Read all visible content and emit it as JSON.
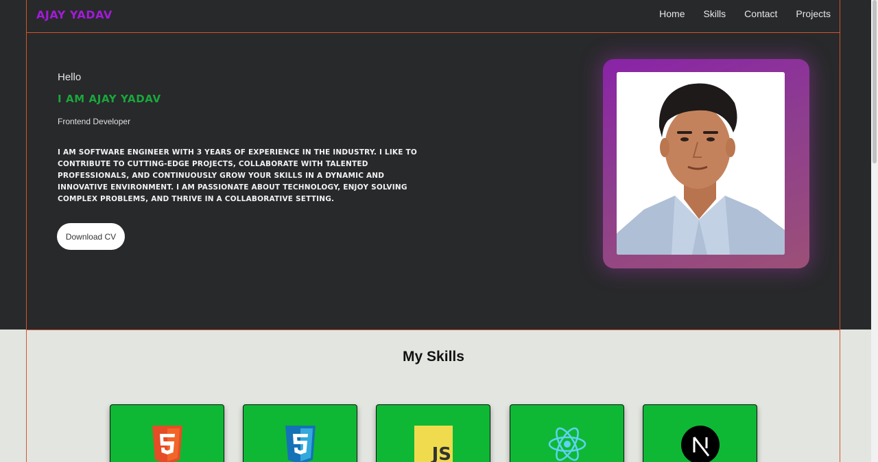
{
  "nav": {
    "logo": "AJAY YADAV",
    "links": [
      "Home",
      "Skills",
      "Contact",
      "Projects"
    ]
  },
  "hero": {
    "greeting": "Hello",
    "name": "I AM AJAY YADAV",
    "role": "Frontend Developer",
    "bio": "I am Software Engineer with 3 years of experience in the industry. I like to contribute to cutting-edge projects, collaborate with talented professionals, and continuously grow your skills in a dynamic and innovative environment. I am passionate about technology, enjoy solving complex problems, and thrive in a collaborative setting.",
    "cv_button": "Download CV"
  },
  "skills": {
    "title": "My Skills",
    "items": [
      {
        "icon": "html5-icon"
      },
      {
        "icon": "css3-icon"
      },
      {
        "icon": "javascript-icon"
      },
      {
        "icon": "react-icon"
      },
      {
        "icon": "nextjs-icon"
      }
    ]
  },
  "colors": {
    "logo": "#a21bd8",
    "name_green": "#19a83b",
    "card_green": "#0fb834",
    "dark_bg": "#28292b",
    "light_bg": "#e3e5e0",
    "guide_line": "#d2562c"
  }
}
